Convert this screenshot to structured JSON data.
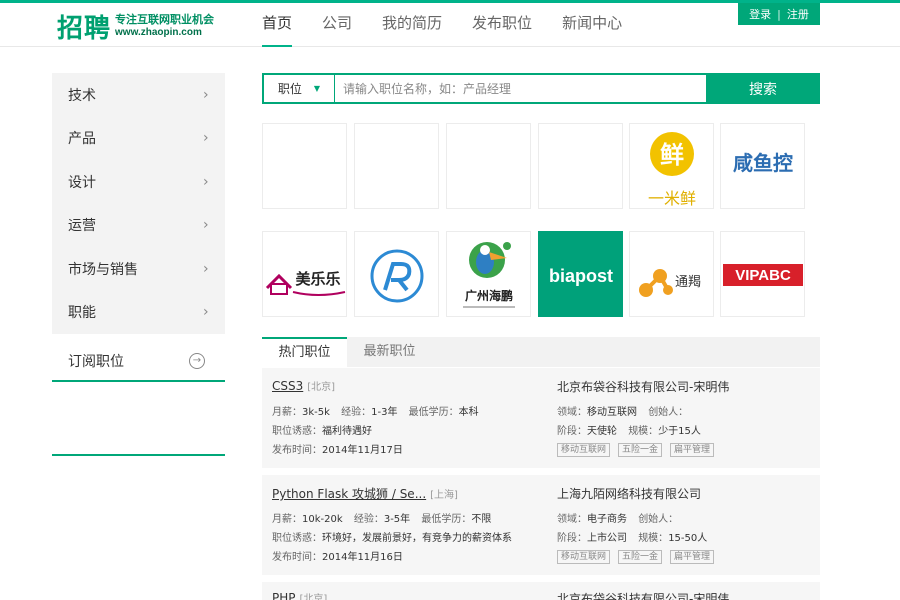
{
  "header": {
    "logo_main": "招聘",
    "logo_slogan": "专注互联网职业机会",
    "logo_url": "www.zhaopin.com",
    "nav": [
      "首页",
      "公司",
      "我的简历",
      "发布职位",
      "新闻中心"
    ],
    "login": "登录",
    "separator": "|",
    "register": "注册"
  },
  "sidebar": {
    "categories": [
      "技术",
      "产品",
      "设计",
      "运营",
      "市场与销售",
      "职能"
    ],
    "subscribe": "订阅职位"
  },
  "search": {
    "type": "职位",
    "placeholder": "请输入职位名称，如：产品经理",
    "button": "搜索"
  },
  "logos": {
    "yimixian": "一米鲜",
    "yimixian_char": "鲜",
    "xianyukong": "咸鱼控",
    "meilele": "美乐乐",
    "guangzhou_haipeng": "广州海鹏",
    "biapost": "biapost",
    "tongjie": "通羯",
    "vipabc": "VIPABC"
  },
  "tabs": [
    "热门职位",
    "最新职位"
  ],
  "jobs": [
    {
      "title": "CSS3",
      "city": "[北京]",
      "salary_label": "月薪：",
      "salary": "3k-5k",
      "exp_label": "经验：",
      "exp": "1-3年",
      "edu_label": "最低学历：",
      "edu": "本科",
      "perk_label": "职位诱惑：",
      "perk": "福利待遇好",
      "date_label": "发布时间：",
      "date": "2014年11月17日",
      "company": "北京布袋谷科技有限公司-宋明伟",
      "field_label": "领域：",
      "field": "移动互联网",
      "founder_label": "创始人：",
      "founder": "",
      "stage_label": "阶段：",
      "stage": "天使轮",
      "scale_label": "规模：",
      "scale": "少于15人",
      "tags": [
        "移动互联网",
        "五险一金",
        "扁平管理"
      ]
    },
    {
      "title": "Python Flask 攻城狮 / Se...",
      "city": "[上海]",
      "salary_label": "月薪：",
      "salary": "10k-20k",
      "exp_label": "经验：",
      "exp": "3-5年",
      "edu_label": "最低学历：",
      "edu": "不限",
      "perk_label": "职位诱惑：",
      "perk": "环境好，发展前景好，有竞争力的薪资体系",
      "date_label": "发布时间：",
      "date": "2014年11月16日",
      "company": "上海九陌网络科技有限公司",
      "field_label": "领域：",
      "field": "电子商务",
      "founder_label": "创始人：",
      "founder": "",
      "stage_label": "阶段：",
      "stage": "上市公司",
      "scale_label": "规模：",
      "scale": "15-50人",
      "tags": [
        "移动互联网",
        "五险一金",
        "扁平管理"
      ]
    },
    {
      "title": "PHP",
      "city": "[北京]",
      "company": "北京布袋谷科技有限公司-宋明伟"
    }
  ],
  "colors": {
    "brand": "#00a779",
    "accent": "#00b38a",
    "yimixian_yellow": "#f2c200",
    "xianyukong_blue": "#2c6db2",
    "biapost_green": "#00a17a",
    "vipabc_red": "#d8202a",
    "meilele_magenta": "#b0005e"
  }
}
